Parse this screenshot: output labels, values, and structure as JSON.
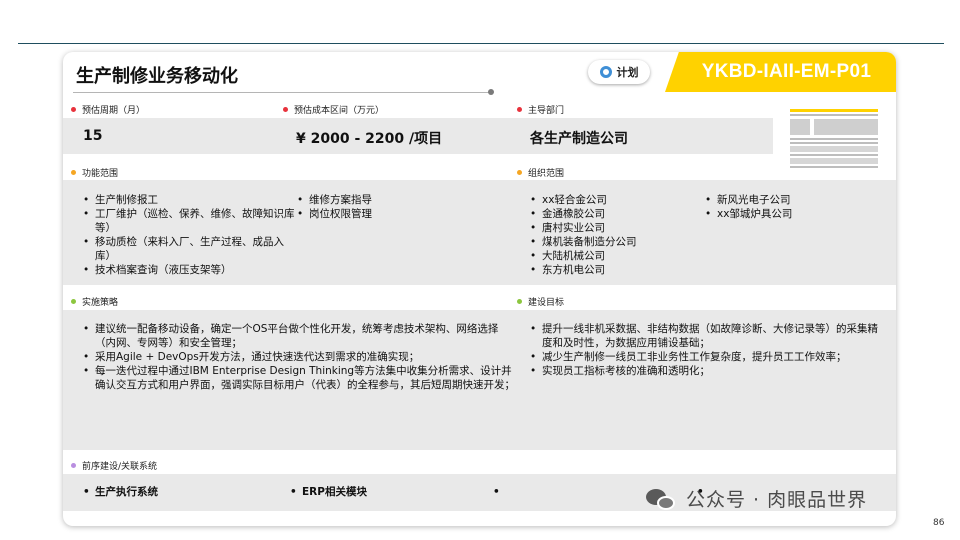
{
  "header": {
    "title": "生产制修业务移动化",
    "status_label": "计划",
    "status_icon": "ring-icon",
    "code": "YKBD-IAII-EM-P01"
  },
  "fields": {
    "period": {
      "label": "预估周期（月）",
      "value": "15",
      "color": "#e8323c"
    },
    "cost": {
      "label": "预估成本区间（万元）",
      "value": "¥ 2000 - 2200 /项目",
      "color": "#e8323c"
    },
    "department": {
      "label": "主导部门",
      "value": "各生产制造公司",
      "color": "#e8323c"
    }
  },
  "function_scope": {
    "label": "功能范围",
    "color": "#f5a623",
    "col1": [
      "生产制修报工",
      "工厂维护（巡检、保养、维修、故障知识库等）",
      "移动质检（来料入厂、生产过程、成品入库）",
      "技术档案查询（液压支架等）"
    ],
    "col2": [
      "维修方案指导",
      "岗位权限管理"
    ]
  },
  "org_scope": {
    "label": "组织范围",
    "color": "#f5a623",
    "col1": [
      "xx轻合金公司",
      "金通橡胶公司",
      "唐村实业公司",
      "煤机装备制造分公司",
      "大陆机械公司",
      "东方机电公司"
    ],
    "col2": [
      "新风光电子公司",
      "xx邹城炉具公司"
    ]
  },
  "strategy": {
    "label": "实施策略",
    "color": "#8cc63f",
    "items": [
      "建议统一配备移动设备，确定一个OS平台做个性化开发，统筹考虑技术架构、网络选择（内网、专网等）和安全管理；",
      "采用Agile + DevOps开发方法，通过快速迭代达到需求的准确实现；",
      "每一迭代过程中通过IBM Enterprise Design Thinking等方法集中收集分析需求、设计并确认交互方式和用户界面，强调实际目标用户（代表）的全程参与，其后短周期快速开发；"
    ]
  },
  "goals": {
    "label": "建设目标",
    "color": "#8cc63f",
    "items": [
      "提升一线非机采数据、非结构数据（如故障诊断、大修记录等）的采集精度和及时性，为数据应用铺设基础；",
      "减少生产制修一线员工非业务性工作复杂度，提升员工工作效率；",
      "实现员工指标考核的准确和透明化；"
    ]
  },
  "related": {
    "label": "前序建设/关联系统",
    "color": "#b98ee0",
    "items": [
      "生产执行系统",
      "ERP相关模块",
      "",
      ""
    ]
  },
  "watermark": "公众号 · 肉眼品世界",
  "page_number": "86"
}
